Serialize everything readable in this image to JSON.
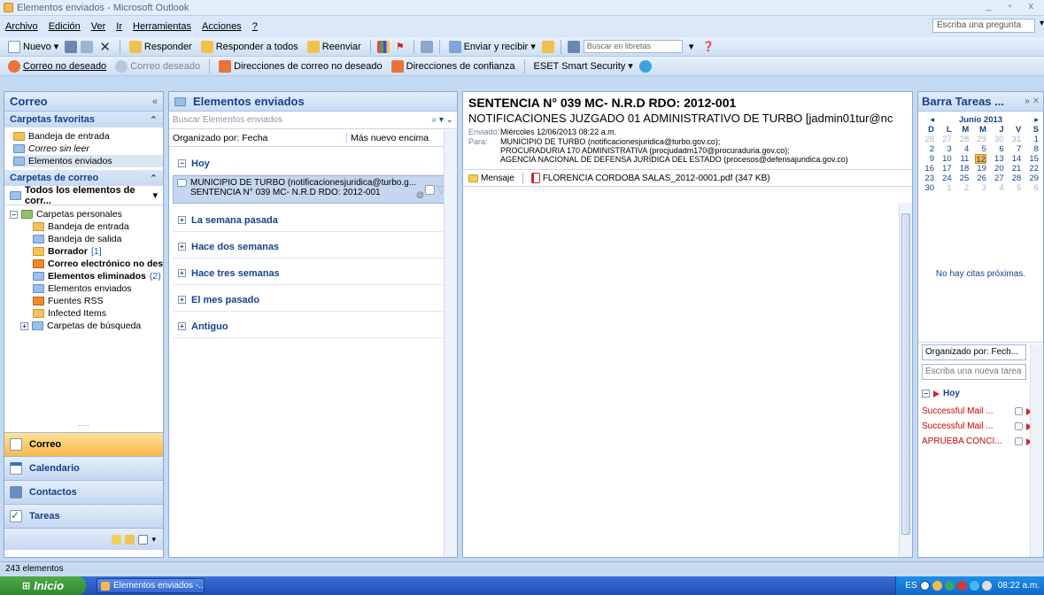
{
  "window": {
    "title": "Elementos enviados - Microsoft Outlook",
    "controls": "_ ▫ x"
  },
  "menu": {
    "items": [
      "Archivo",
      "Edición",
      "Ver",
      "Ir",
      "Herramientas",
      "Acciones",
      "?"
    ],
    "help_placeholder": "Escriba una pregunta"
  },
  "toolbar1": {
    "new": "Nuevo",
    "reply": "Responder",
    "reply_all": "Responder a todos",
    "forward": "Reenviar",
    "send_receive": "Enviar y recibir",
    "search_books": "Buscar en libretas"
  },
  "toolbar2": {
    "junk": "Correo no deseado",
    "not_junk": "Correo deseado",
    "blocked": "Direcciones de correo no deseado",
    "safe": "Direcciones de confianza",
    "eset": "ESET Smart Security"
  },
  "nav": {
    "title": "Correo",
    "favorites_title": "Carpetas favoritas",
    "favorites": [
      "Bandeja de entrada",
      "Correo sin leer",
      "Elementos enviados"
    ],
    "mail_title": "Carpetas de correo",
    "all_items": "Todos los elementos de corr...",
    "root": "Carpetas personales",
    "folders": [
      {
        "name": "Bandeja de entrada",
        "count": ""
      },
      {
        "name": "Bandeja de salida",
        "count": ""
      },
      {
        "name": "Borrador",
        "count": "[1]"
      },
      {
        "name": "Correo electrónico no desea",
        "count": ""
      },
      {
        "name": "Elementos eliminados",
        "count": "(2)"
      },
      {
        "name": "Elementos enviados",
        "count": ""
      },
      {
        "name": "Fuentes RSS",
        "count": ""
      },
      {
        "name": "Infected Items",
        "count": ""
      }
    ],
    "search_folders": "Carpetas de búsqueda",
    "dots": ".....",
    "buttons": [
      "Correo",
      "Calendario",
      "Contactos",
      "Tareas"
    ]
  },
  "list": {
    "title": "Elementos enviados",
    "search_placeholder": "Buscar Elementos enviados",
    "sort_by": "Organizado por: Fecha",
    "sort_order": "Más nuevo encima",
    "groups": [
      "Hoy",
      "La semana pasada",
      "Hace dos semanas",
      "Hace tres semanas",
      "El mes pasado",
      "Antiguo"
    ],
    "message": {
      "to": "MUNICIPIO DE TURBO (notificacionesjuridica@turbo.g...",
      "subject": "SENTENCIA N° 039 MC- N.R.D RDO: 2012-001"
    }
  },
  "reading": {
    "subject": "SENTENCIA N° 039 MC- N.R.D RDO: 2012-001",
    "from": "NOTIFICACIONES JUZGADO 01 ADMINISTRATIVO DE TURBO [jadmin01tur@nc",
    "sent_label": "Enviado:",
    "sent_value": "Miércoles 12/06/2013 08:22 a.m.",
    "to_label": "Para:",
    "to_lines": [
      "MUNICIPIO DE TURBO (notificacionesjuridica@turbo.gov.co);",
      "PROCURADURIA 170 ADMINISTRATIVA (procjudadm170@procuraduria.gov.co);",
      "AGENCIA NACIONAL DE DEFENSA JURÍDICA DEL ESTADO (procesos@defensajuridica.gov.co)"
    ],
    "tab_message": "Mensaje",
    "attachment": "FLORENCIA CORDOBA SALAS_2012-0001.pdf (347 KB)"
  },
  "todo": {
    "title": "Barra Tareas ...",
    "month": "Junio 2013",
    "weekdays": [
      "D",
      "L",
      "M",
      "M",
      "J",
      "V",
      "S"
    ],
    "weeks": [
      [
        "26",
        "27",
        "28",
        "29",
        "30",
        "31",
        "1"
      ],
      [
        "2",
        "3",
        "4",
        "5",
        "6",
        "7",
        "8"
      ],
      [
        "9",
        "10",
        "11",
        "12",
        "13",
        "14",
        "15"
      ],
      [
        "16",
        "17",
        "18",
        "19",
        "20",
        "21",
        "22"
      ],
      [
        "23",
        "24",
        "25",
        "26",
        "27",
        "28",
        "29"
      ],
      [
        "30",
        "1",
        "2",
        "3",
        "4",
        "5",
        "6"
      ]
    ],
    "no_appointments": "No hay citas próximas.",
    "tasks_sort": "Organizado por: Fech...",
    "new_task_placeholder": "Escriba una nueva tarea",
    "today_group": "Hoy",
    "tasks": [
      "Successful Mail ...",
      "Successful Mail ...",
      "APRUEBA CONCI..."
    ]
  },
  "status": {
    "count": "243 elementos"
  },
  "taskbar": {
    "start": "Inicio",
    "task": "Elementos enviados -...",
    "lang": "ES",
    "time": "08:22 a.m."
  }
}
